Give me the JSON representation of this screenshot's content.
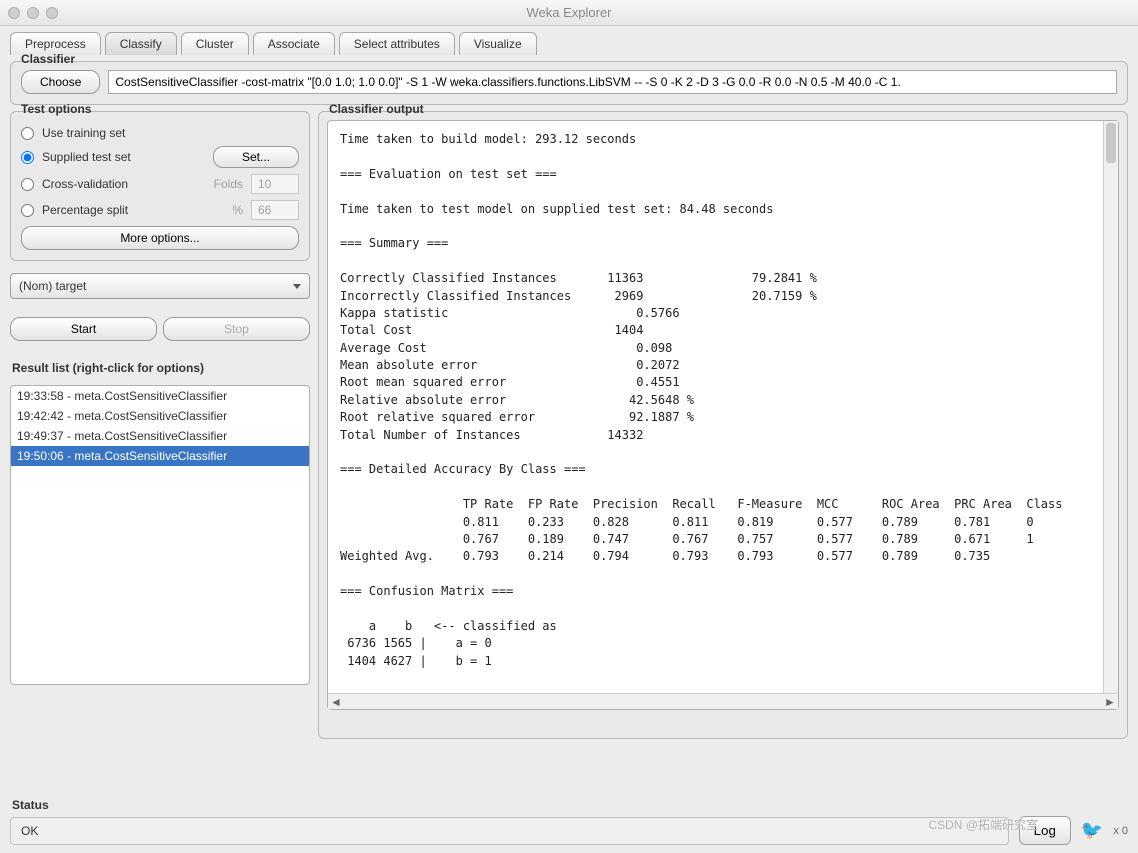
{
  "window": {
    "title": "Weka Explorer"
  },
  "tabs": [
    "Preprocess",
    "Classify",
    "Cluster",
    "Associate",
    "Select attributes",
    "Visualize"
  ],
  "active_tab": 1,
  "classifier": {
    "legend": "Classifier",
    "choose_label": "Choose",
    "config": "CostSensitiveClassifier -cost-matrix \"[0.0 1.0; 1.0 0.0]\" -S 1 -W weka.classifiers.functions.LibSVM -- -S 0 -K 2 -D 3 -G 0.0 -R 0.0 -N 0.5 -M 40.0 -C 1."
  },
  "test_options": {
    "legend": "Test options",
    "opts": {
      "use_training": "Use training set",
      "supplied": "Supplied test set",
      "set_btn": "Set...",
      "cv": "Cross-validation",
      "cv_lbl": "Folds",
      "cv_val": "10",
      "split": "Percentage split",
      "split_lbl": "%",
      "split_val": "66"
    },
    "more": "More options...",
    "target": "(Nom) target",
    "start": "Start",
    "stop": "Stop"
  },
  "result_list": {
    "legend": "Result list (right-click for options)",
    "items": [
      "19:33:58 - meta.CostSensitiveClassifier",
      "19:42:42 - meta.CostSensitiveClassifier",
      "19:49:37 - meta.CostSensitiveClassifier",
      "19:50:06 - meta.CostSensitiveClassifier"
    ],
    "selected": 3
  },
  "output": {
    "legend": "Classifier output",
    "text": "Time taken to build model: 293.12 seconds\n\n=== Evaluation on test set ===\n\nTime taken to test model on supplied test set: 84.48 seconds\n\n=== Summary ===\n\nCorrectly Classified Instances       11363               79.2841 %\nIncorrectly Classified Instances      2969               20.7159 %\nKappa statistic                          0.5766\nTotal Cost                            1404    \nAverage Cost                             0.098 \nMean absolute error                      0.2072\nRoot mean squared error                  0.4551\nRelative absolute error                 42.5648 %\nRoot relative squared error             92.1887 %\nTotal Number of Instances            14332     \n\n=== Detailed Accuracy By Class ===\n\n                 TP Rate  FP Rate  Precision  Recall   F-Measure  MCC      ROC Area  PRC Area  Class\n                 0.811    0.233    0.828      0.811    0.819      0.577    0.789     0.781     0\n                 0.767    0.189    0.747      0.767    0.757      0.577    0.789     0.671     1\nWeighted Avg.    0.793    0.214    0.794      0.793    0.793      0.577    0.789     0.735     \n\n=== Confusion Matrix ===\n\n    a    b   <-- classified as\n 6736 1565 |    a = 0\n 1404 4627 |    b = 1\n"
  },
  "status": {
    "legend": "Status",
    "text": "OK",
    "log": "Log",
    "x0": "x 0"
  },
  "watermark": "CSDN @拓端研究室"
}
